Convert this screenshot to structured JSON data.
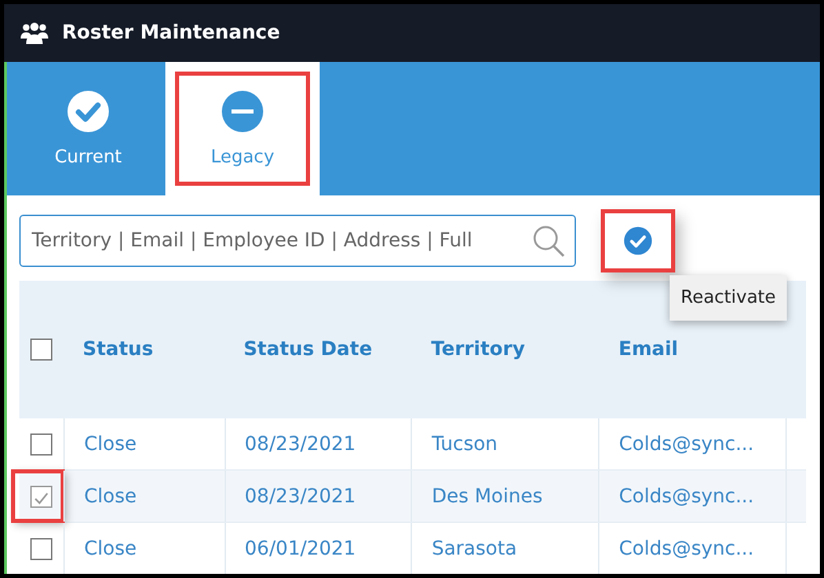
{
  "window": {
    "title": "Roster Maintenance"
  },
  "tabs": [
    {
      "label": "Current",
      "kind": "check",
      "selected": false,
      "highlighted": false
    },
    {
      "label": "Legacy",
      "kind": "minus",
      "selected": true,
      "highlighted": true
    }
  ],
  "search": {
    "placeholder": "Territory | Email | Employee ID | Address | Full"
  },
  "reactivate": {
    "highlighted": true,
    "tooltip": "Reactivate"
  },
  "table": {
    "header_checked": false,
    "columns": [
      "Status",
      "Status Date",
      "Territory",
      "Email"
    ],
    "rows": [
      {
        "checked": false,
        "highlighted": false,
        "cells": [
          "Close",
          "08/23/2021",
          "Tucson",
          "Colds@sync..."
        ]
      },
      {
        "checked": true,
        "highlighted": true,
        "cells": [
          "Close",
          "08/23/2021",
          "Des Moines",
          "Colds@sync..."
        ]
      },
      {
        "checked": false,
        "highlighted": false,
        "cells": [
          "Close",
          "06/01/2021",
          "Sarasota",
          "Colds@sync..."
        ]
      }
    ]
  }
}
